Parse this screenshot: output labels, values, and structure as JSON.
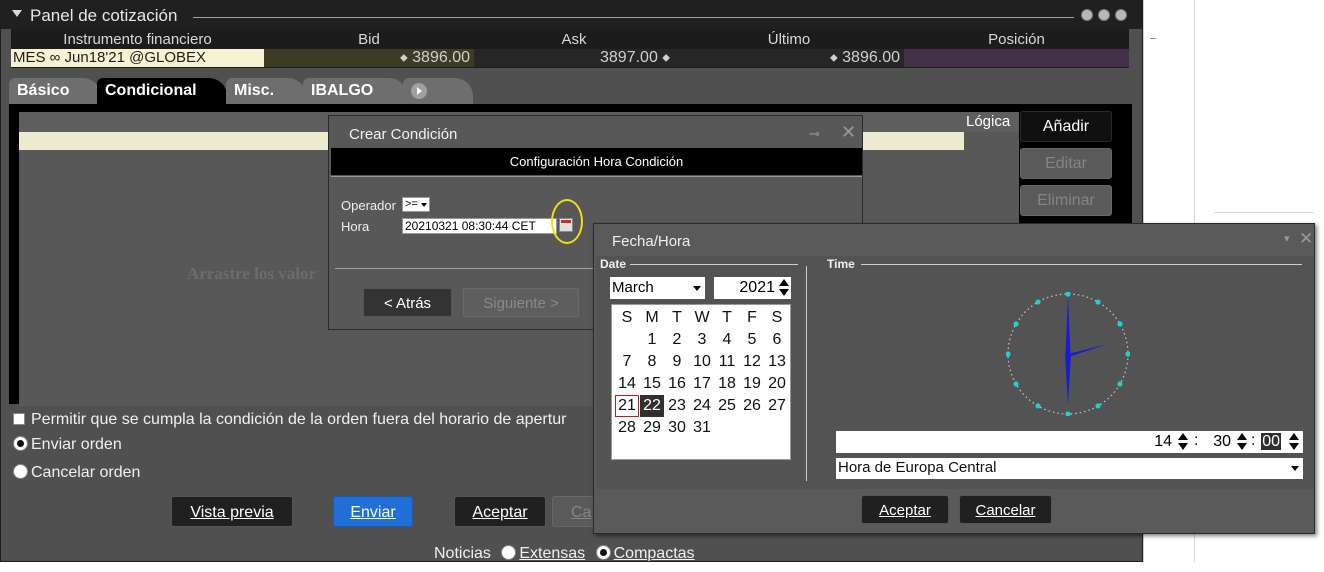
{
  "panel": {
    "title": "Panel de cotización"
  },
  "quote": {
    "headers": [
      "Instrumento financiero",
      "Bid",
      "Ask",
      "Último",
      "Posición"
    ],
    "instrument": "MES ∞ Jun18'21 @GLOBEX",
    "bid": "3896.00",
    "ask": "3897.00",
    "last": "3896.00",
    "position": ""
  },
  "tabs": [
    {
      "label": "Básico",
      "active": false
    },
    {
      "label": "Condicional",
      "active": true
    },
    {
      "label": "Misc.",
      "active": false
    },
    {
      "label": "IBALGO",
      "active": false
    }
  ],
  "conditions": {
    "logic_header": "Lógica",
    "drag_hint": "Arrastre los valor"
  },
  "side_buttons": {
    "add": "Añadir",
    "edit": "Editar",
    "delete": "Eliminar"
  },
  "options": {
    "allow_outside_hours": "Permitir que se cumpla la condición de la orden fuera del horario de apertur",
    "send_order": "Enviar orden",
    "cancel_order": "Cancelar orden"
  },
  "bottom_buttons": {
    "preview": "Vista previa",
    "send": "Enviar",
    "accept": "Aceptar",
    "cancel_partial": "Ca"
  },
  "news": {
    "label": "Noticias",
    "extended": "Extensas",
    "compact": "Compactas"
  },
  "create_condition": {
    "title": "Crear Condición",
    "subtitle": "Configuración Hora Condición",
    "operator_label": "Operador",
    "operator_value": ">=",
    "time_label": "Hora",
    "time_value": "20210321 08:30:44 CET",
    "back": "< Atrás",
    "next": "Siguiente >"
  },
  "datetime_dialog": {
    "title": "Fecha/Hora",
    "date_section": "Date",
    "time_section": "Time",
    "month": "March",
    "year": "2021",
    "weekdays": [
      "S",
      "M",
      "T",
      "W",
      "T",
      "F",
      "S"
    ],
    "today": 21,
    "selected": 22,
    "hour": "14",
    "minute": "30",
    "second": "00",
    "timezone": "Hora de Europa Central",
    "accept": "Aceptar",
    "cancel": "Cancelar"
  },
  "colors": {
    "accent_blue": "#1f6fd6",
    "instrument_bg": "#f6f3d2",
    "position_bg": "#45304a",
    "highlight_ring": "#f0e010",
    "clock_hands": "#1a1ad8",
    "clock_dots": "#20d0d0"
  }
}
